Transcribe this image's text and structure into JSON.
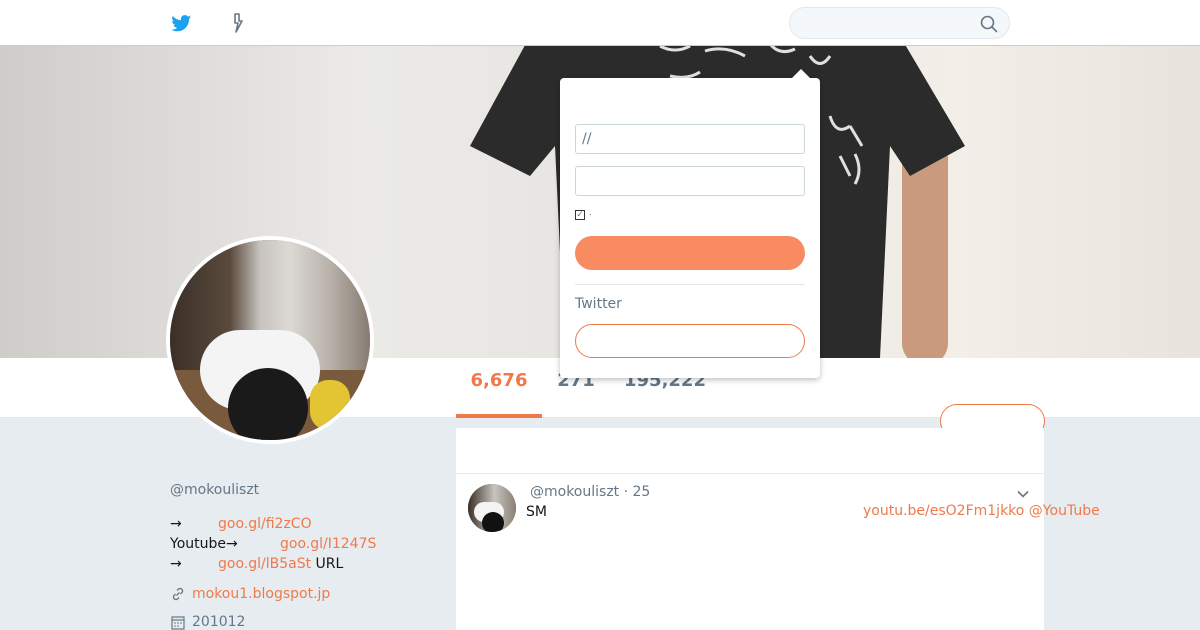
{
  "nav": {
    "home_icon": "twitter-bird-icon",
    "moments_icon": "lightning-icon",
    "search_placeholder": "",
    "search_icon": "search-icon"
  },
  "login_popup": {
    "username_placeholder": "//",
    "password_placeholder": "",
    "remember_label": "·",
    "remember_checked": true,
    "login_button_label": "",
    "signup_prompt": "Twitter",
    "signup_button_label": ""
  },
  "profile": {
    "name": "",
    "handle": "@mokouliszt",
    "bio": [
      {
        "prefix": "→",
        "link": "goo.gl/fi2zCO",
        "suffix": ""
      },
      {
        "prefix": "Youtube→",
        "link": "goo.gl/I1247S",
        "suffix": ""
      },
      {
        "prefix": "→",
        "link": "goo.gl/lB5aSt",
        "suffix": " URL"
      }
    ],
    "website": "mokou1.blogspot.jp",
    "joined": "201012",
    "follow_button_label": ""
  },
  "stats": [
    {
      "label": "",
      "value": "6,676",
      "active": true
    },
    {
      "label": "",
      "value": "271",
      "active": false
    },
    {
      "label": "",
      "value": "195,222",
      "active": false
    }
  ],
  "tweet": {
    "handle_time": "@mokouliszt · 25",
    "text": "SM",
    "link": "youtu.be/esO2Fm1jkko @YouTube"
  },
  "colors": {
    "accent": "#f0794b",
    "login_button": "#f98b62",
    "bird": "#1da1f2",
    "muted": "#657786",
    "background": "#e6ecf0"
  }
}
